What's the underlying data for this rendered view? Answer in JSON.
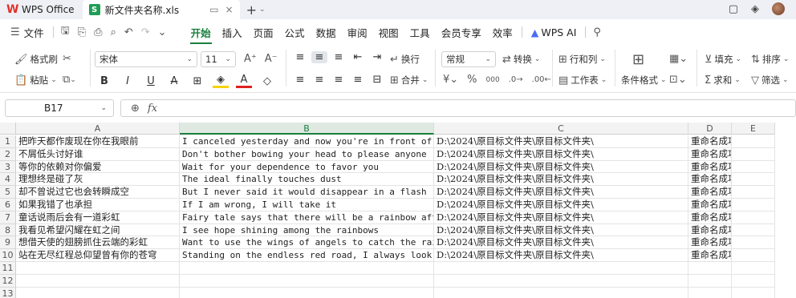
{
  "titlebar": {
    "app_name": "WPS Office",
    "doc_tab": "新文件夹名称.xls",
    "tab_restore": "▭",
    "tab_close": "×",
    "new_tab": "+",
    "new_tab_caret": "⌄"
  },
  "menubar": {
    "file": "文件",
    "items": [
      "开始",
      "插入",
      "页面",
      "公式",
      "数据",
      "审阅",
      "视图",
      "工具",
      "会员专享",
      "效率"
    ],
    "active": "开始",
    "wps_ai": "WPS AI"
  },
  "ribbon": {
    "format_painter": "格式刷",
    "paste": "粘贴",
    "font_name": "宋体",
    "font_size": "11",
    "wrap_text": "换行",
    "merge": "合并",
    "number_format": "常规",
    "convert": "转换",
    "row_col": "行和列",
    "worksheet": "工作表",
    "conditional_format": "条件格式",
    "fill": "填充",
    "sort": "排序",
    "sum": "求和",
    "filter": "筛选",
    "percent": "%",
    "thousands": "000"
  },
  "formula_bar": {
    "cell_ref": "B17",
    "fx": "fx",
    "value": ""
  },
  "sheet": {
    "columns": [
      "A",
      "B",
      "C",
      "D",
      "E"
    ],
    "selected_column": "B",
    "rows": [
      {
        "n": "1",
        "a": "把昨天都作废现在你在我眼前",
        "b": "I canceled yesterday and now you're in front of me",
        "c": "D:\\2024\\原目标文件夹\\原目标文件夹\\",
        "d": "重命名成功"
      },
      {
        "n": "2",
        "a": "不屑低头讨好谁",
        "b": "Don't bother bowing your head to please anyone",
        "c": "D:\\2024\\原目标文件夹\\原目标文件夹\\",
        "d": "重命名成功"
      },
      {
        "n": "3",
        "a": "等你的依赖对你偏爱",
        "b": "Wait for your dependence to favor you",
        "c": "D:\\2024\\原目标文件夹\\原目标文件夹\\",
        "d": "重命名成功"
      },
      {
        "n": "4",
        "a": "理想终是碰了灰",
        "b": "The ideal finally touches dust",
        "c": "D:\\2024\\原目标文件夹\\原目标文件夹\\",
        "d": "重命名成功"
      },
      {
        "n": "5",
        "a": "却不曾说过它也会转瞬成空",
        "b": "But I never said it would disappear in a flash",
        "c": "D:\\2024\\原目标文件夹\\原目标文件夹\\",
        "d": "重命名成功"
      },
      {
        "n": "6",
        "a": "如果我错了也承担",
        "b": "If I am wrong, I will take it",
        "c": "D:\\2024\\原目标文件夹\\原目标文件夹\\",
        "d": "重命名成功"
      },
      {
        "n": "7",
        "a": "童话说雨后会有一道彩虹",
        "b": "Fairy tale says that there will be a rainbow after t",
        "c": "D:\\2024\\原目标文件夹\\原目标文件夹\\",
        "d": "重命名成功"
      },
      {
        "n": "8",
        "a": "我看见希望闪耀在虹之间",
        "b": "I see hope shining among the rainbows",
        "c": "D:\\2024\\原目标文件夹\\原目标文件夹\\",
        "d": "重命名成功"
      },
      {
        "n": "9",
        "a": "想借天使的翅膀抓住云端的彩虹",
        "b": "Want to use the wings of angels to catch the rainbow",
        "c": "D:\\2024\\原目标文件夹\\原目标文件夹\\",
        "d": "重命名成功"
      },
      {
        "n": "10",
        "a": "站在无尽红程总仰望曾有你的苍穹",
        "b": "Standing on the endless red road, I always look up t",
        "c": "D:\\2024\\原目标文件夹\\原目标文件夹\\",
        "d": "重命名成功"
      },
      {
        "n": "11",
        "a": "",
        "b": "",
        "c": "",
        "d": ""
      },
      {
        "n": "12",
        "a": "",
        "b": "",
        "c": "",
        "d": ""
      },
      {
        "n": "13",
        "a": "",
        "b": "",
        "c": "",
        "d": ""
      }
    ]
  },
  "colors": {
    "accent_green": "#1a7f3e",
    "wps_red": "#e0322b",
    "sheet_green": "#1f9d55"
  }
}
